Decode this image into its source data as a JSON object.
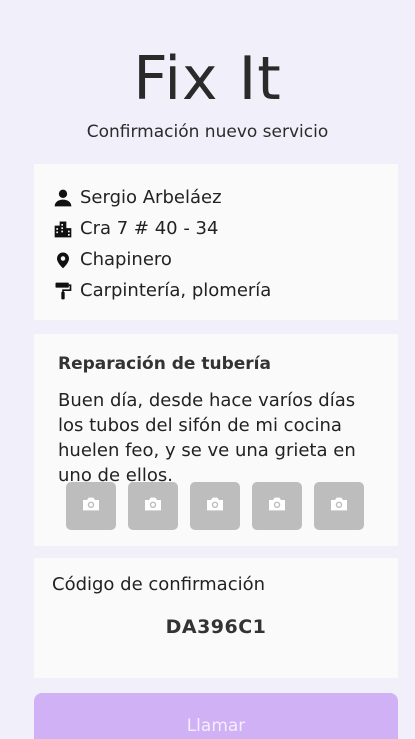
{
  "header": {
    "title": "Fix It",
    "subtitle": "Confirmación nuevo servicio"
  },
  "contact": {
    "name": "Sergio Arbeláez",
    "address": "Cra 7 # 40 - 34",
    "neighborhood": "Chapinero",
    "services": "Carpintería, plomería"
  },
  "request": {
    "title": "Reparación de tubería",
    "description": "Buen día, desde hace varíos días los tubos del sifón de mi cocina huelen feo, y se ve una grieta en uno de ellos.",
    "photo_icon": "camera-icon",
    "photo_count": 5
  },
  "confirmation": {
    "label": "Código de confirmación",
    "code": "DA396C1"
  },
  "actions": {
    "call_label": "Llamar",
    "call_color": "#d1b1f6"
  }
}
